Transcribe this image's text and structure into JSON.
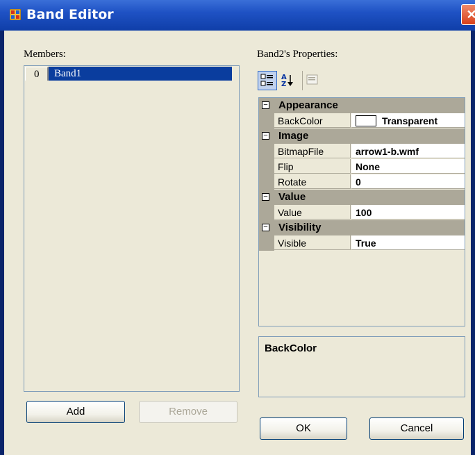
{
  "window": {
    "title": "Band Editor",
    "close_glyph": "✕",
    "icon": "band-editor-app-icon"
  },
  "members": {
    "label": "Members:",
    "items": [
      {
        "index": "0",
        "name": "Band1",
        "selected": true
      }
    ],
    "add_button": "Add",
    "remove_button": "Remove"
  },
  "properties": {
    "label": "Band2's Properties:",
    "toolbar": [
      {
        "icon": "categorized-icon",
        "active": true
      },
      {
        "icon": "alphabetical-sort-icon",
        "active": false
      },
      {
        "icon": "property-pages-icon",
        "active": false,
        "disabled": true
      }
    ],
    "categories": [
      {
        "name": "Appearance",
        "toggle": "⊟",
        "props": [
          {
            "name": "BackColor",
            "value": "Transparent",
            "swatch": "transparent"
          }
        ]
      },
      {
        "name": "Image",
        "toggle": "⊟",
        "props": [
          {
            "name": "BitmapFile",
            "value": "arrow1-b.wmf"
          },
          {
            "name": "Flip",
            "value": "None"
          },
          {
            "name": "Rotate",
            "value": "0"
          }
        ]
      },
      {
        "name": "Value",
        "toggle": "⊟",
        "props": [
          {
            "name": "Value",
            "value": "100"
          }
        ]
      },
      {
        "name": "Visibility",
        "toggle": "⊟",
        "props": [
          {
            "name": "Visible",
            "value": "True"
          }
        ]
      }
    ],
    "description_title": "BackColor"
  },
  "footer": {
    "ok_button": "OK",
    "cancel_button": "Cancel"
  },
  "colors": {
    "title_bar": "#1f52c4",
    "dialog_bg": "#ece9d8",
    "selection": "#0a3d9e",
    "category_bg": "#aca899"
  }
}
